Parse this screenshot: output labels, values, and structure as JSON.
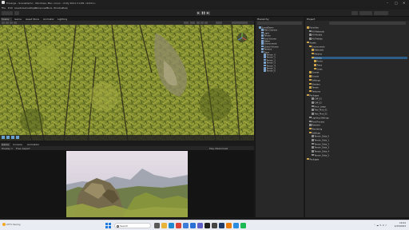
{
  "window": {
    "title": "EnLarge - SceneDemo - Windows, Mac, Linux - Unity 2021.3.16f1 <DX11>",
    "controls": [
      "–",
      "□",
      "✕"
    ]
  },
  "menu": [
    "File",
    "Edit",
    "Assets",
    "GameObject",
    "Component",
    "Tools",
    "Window",
    "Help"
  ],
  "scene_tabs": [
    {
      "label": "Scene",
      "active": true
    },
    {
      "label": "Game",
      "active": false
    },
    {
      "label": "Asset Store",
      "active": false
    },
    {
      "label": "Animator",
      "active": false
    },
    {
      "label": "Lighting",
      "active": false
    }
  ],
  "game_tabs": [
    {
      "label": "Game",
      "active": true
    },
    {
      "label": "Console",
      "active": false
    },
    {
      "label": "Animation",
      "active": false
    }
  ],
  "game_bar": {
    "display": "Display 1",
    "aspect": "Free Aspect",
    "play_mode": "Play Maximized"
  },
  "hierarchy": {
    "title": "Hierarchy",
    "rows": [
      {
        "label": "SceneDemo",
        "indent": 0,
        "type": "go"
      },
      {
        "label": "Main Camera",
        "indent": 1,
        "type": "go"
      },
      {
        "label": "Light",
        "indent": 1,
        "type": "go"
      },
      {
        "label": "Terrain",
        "indent": 1,
        "type": "go"
      },
      {
        "label": "Post Volume",
        "indent": 1,
        "type": "go"
      },
      {
        "label": "Water",
        "indent": 1,
        "type": "go"
      },
      {
        "label": "Environment",
        "indent": 1,
        "type": "go"
      },
      {
        "label": "Global Volume",
        "indent": 1,
        "type": "go"
      },
      {
        "label": "Terrains",
        "indent": 1,
        "type": "go"
      },
      {
        "label": "Trees",
        "indent": 1,
        "type": "go"
      },
      {
        "label": "Terrain_0",
        "indent": 2,
        "type": "go"
      },
      {
        "label": "Terrain_1",
        "indent": 2,
        "type": "go"
      },
      {
        "label": "Terrain_2",
        "indent": 2,
        "type": "go"
      },
      {
        "label": "Terrain_3",
        "indent": 2,
        "type": "go"
      },
      {
        "label": "Terrain_4",
        "indent": 2,
        "type": "go"
      },
      {
        "label": "Terrain_5",
        "indent": 2,
        "type": "go"
      },
      {
        "label": "Terrain_6",
        "indent": 2,
        "type": "go"
      }
    ]
  },
  "project": {
    "title": "Project",
    "rows": [
      {
        "label": "Favorites",
        "indent": 0,
        "type": "folder"
      },
      {
        "label": "All Materials",
        "indent": 1,
        "type": "asset"
      },
      {
        "label": "All Models",
        "indent": 1,
        "type": "asset"
      },
      {
        "label": "All Prefabs",
        "indent": 1,
        "type": "asset"
      },
      {
        "label": "Assets",
        "indent": 0,
        "type": "folder"
      },
      {
        "label": "Environment",
        "indent": 1,
        "type": "folder"
      },
      {
        "label": "Materials",
        "indent": 2,
        "type": "folder"
      },
      {
        "label": "Meshes",
        "indent": 2,
        "type": "folder"
      },
      {
        "label": "Prefabs",
        "indent": 2,
        "type": "folder",
        "selected": true
      },
      {
        "label": "Rocks",
        "indent": 3,
        "type": "folder"
      },
      {
        "label": "Trees",
        "indent": 3,
        "type": "folder"
      },
      {
        "label": "Grass",
        "indent": 3,
        "type": "folder"
      },
      {
        "label": "Scenes",
        "indent": 1,
        "type": "folder"
      },
      {
        "label": "Scripts",
        "indent": 1,
        "type": "folder"
      },
      {
        "label": "Settings",
        "indent": 1,
        "type": "folder"
      },
      {
        "label": "Shaders",
        "indent": 1,
        "type": "folder"
      },
      {
        "label": "Terrain",
        "indent": 1,
        "type": "folder"
      },
      {
        "label": "Textures",
        "indent": 1,
        "type": "folder"
      },
      {
        "label": "Packages",
        "indent": 0,
        "type": "folder"
      },
      {
        "label": "Cliff_01",
        "indent": 2,
        "type": "asset"
      },
      {
        "label": "Cliff_02",
        "indent": 2,
        "type": "asset"
      },
      {
        "label": "Rock_Large",
        "indent": 2,
        "type": "asset"
      },
      {
        "label": "Tree_Pine_01",
        "indent": 2,
        "type": "asset"
      },
      {
        "label": "Tree_Pine_02",
        "indent": 2,
        "type": "asset"
      },
      {
        "label": "Lighting Settings",
        "indent": 1,
        "type": "asset"
      },
      {
        "label": "Post Process",
        "indent": 1,
        "type": "asset"
      },
      {
        "label": "Readme",
        "indent": 1,
        "type": "asset"
      },
      {
        "label": "Rendering",
        "indent": 1,
        "type": "folder"
      },
      {
        "label": "Settings",
        "indent": 1,
        "type": "folder"
      },
      {
        "label": "Terrain_Data_0",
        "indent": 2,
        "type": "asset"
      },
      {
        "label": "Terrain_Data_1",
        "indent": 2,
        "type": "asset"
      },
      {
        "label": "Terrain_Data_2",
        "indent": 2,
        "type": "asset"
      },
      {
        "label": "Terrain_Data_3",
        "indent": 2,
        "type": "asset"
      },
      {
        "label": "Terrain_Data_4",
        "indent": 2,
        "type": "asset"
      },
      {
        "label": "Terrain_Data_5",
        "indent": 2,
        "type": "asset"
      },
      {
        "label": "Packages",
        "indent": 0,
        "type": "folder"
      }
    ]
  },
  "taskbar": {
    "weather_temp": "23°C",
    "weather_text": "Sunny",
    "search_placeholder": "Search",
    "tray_icons": "⌃ ☁ ✎ ⊙ ♪",
    "time": "10:41",
    "date": "1/23/2023",
    "apps": [
      {
        "name": "task-view",
        "color": "#5a5a5a"
      },
      {
        "name": "file-explorer",
        "color": "#e8b339"
      },
      {
        "name": "edge",
        "color": "#1f8ad1"
      },
      {
        "name": "chrome",
        "color": "#d9443a"
      },
      {
        "name": "store",
        "color": "#3b7dd8"
      },
      {
        "name": "mail",
        "color": "#2a6fd6"
      },
      {
        "name": "teams",
        "color": "#5b5fc7"
      },
      {
        "name": "unity-hub",
        "color": "#222222"
      },
      {
        "name": "unity",
        "color": "#444444"
      },
      {
        "name": "photoshop",
        "color": "#1e3a66"
      },
      {
        "name": "blender",
        "color": "#e87d0d"
      },
      {
        "name": "vscode",
        "color": "#2a8de0"
      },
      {
        "name": "spotify",
        "color": "#1db954"
      }
    ]
  }
}
